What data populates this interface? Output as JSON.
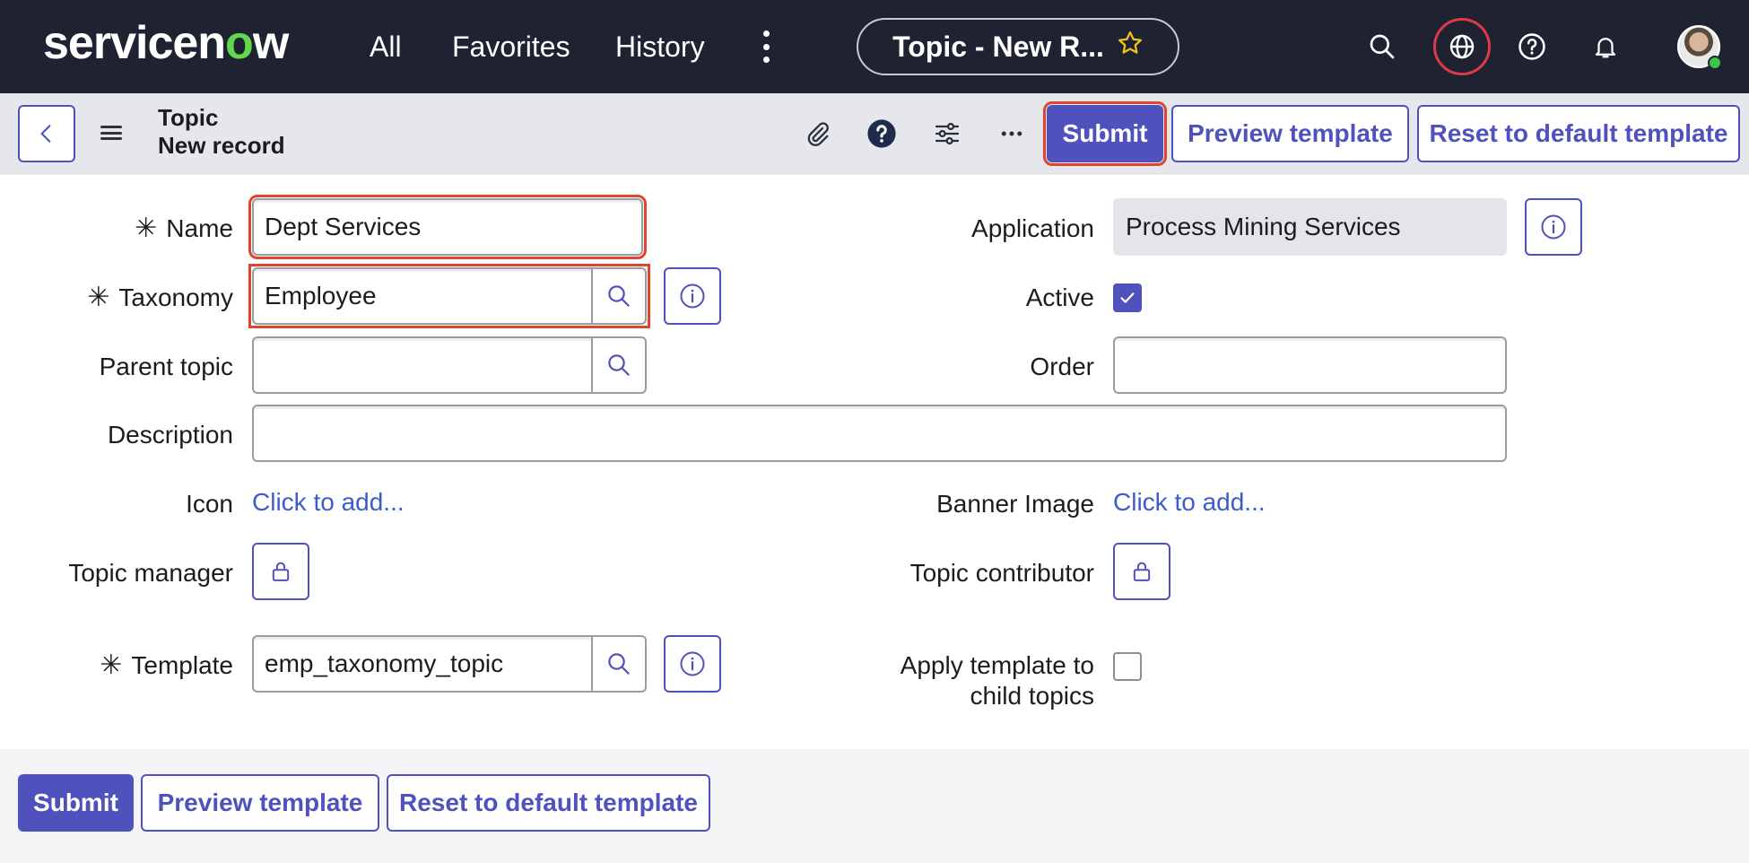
{
  "topnav": {
    "logo": "servicenow",
    "links": [
      "All",
      "Favorites",
      "History"
    ],
    "title_pill": "Topic - New R...",
    "icons": [
      "search-icon",
      "globe-icon",
      "help-icon",
      "bell-icon"
    ]
  },
  "header": {
    "title_line1": "Topic",
    "title_line2": "New record",
    "submit_label": "Submit",
    "preview_label": "Preview template",
    "reset_label": "Reset to default template"
  },
  "form": {
    "name": {
      "label": "Name",
      "value": "Dept Services",
      "required": true
    },
    "taxonomy": {
      "label": "Taxonomy",
      "value": "Employee",
      "required": true
    },
    "parent_topic": {
      "label": "Parent topic",
      "value": ""
    },
    "description": {
      "label": "Description",
      "value": ""
    },
    "icon": {
      "label": "Icon",
      "link": "Click to add..."
    },
    "topic_manager": {
      "label": "Topic manager"
    },
    "template": {
      "label": "Template",
      "value": "emp_taxonomy_topic",
      "required": true
    },
    "application": {
      "label": "Application",
      "value": "Process Mining Services"
    },
    "active": {
      "label": "Active",
      "checked": true
    },
    "order": {
      "label": "Order",
      "value": ""
    },
    "banner_image": {
      "label": "Banner Image",
      "link": "Click to add..."
    },
    "topic_contributor": {
      "label": "Topic contributor"
    },
    "apply_template": {
      "label_line1": "Apply template to",
      "label_line2": "child topics",
      "checked": false
    }
  },
  "footer": {
    "submit_label": "Submit",
    "preview_label": "Preview template",
    "reset_label": "Reset to default template"
  },
  "colors": {
    "nav_bg": "#1f2230",
    "accent": "#4f52bd",
    "link": "#3d5ccc",
    "highlight": "#e0442e",
    "logo_green": "#62d84e"
  }
}
